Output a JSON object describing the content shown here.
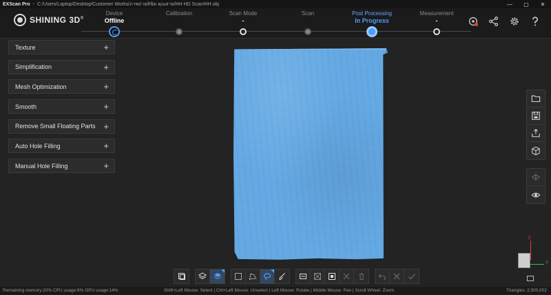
{
  "app": {
    "name": "EXScan Pro",
    "path": "C:/Users/Laptop/Desktop/Customer Works/ภาพถ่ายลิขิต คุณสาย/HH HD Scan/HH.obj",
    "logo": "SHINING 3D",
    "logo_mark": "®"
  },
  "window_controls": [
    "—",
    "▢",
    "✕"
  ],
  "steps": [
    {
      "title": "Device",
      "status": "Offline",
      "node": "sync"
    },
    {
      "title": "Calibration",
      "status": "",
      "node": "dot"
    },
    {
      "title": "Scan Mode",
      "status": "-",
      "node": "ring"
    },
    {
      "title": "Scan",
      "status": "",
      "node": "dot"
    },
    {
      "title": "Post Processing",
      "status": "In Progress",
      "node": "progress"
    },
    {
      "title": "Measurement",
      "status": "-",
      "node": "ring"
    }
  ],
  "header_icons": [
    "scanner-settings-icon",
    "share-icon",
    "gear-icon",
    "help-icon"
  ],
  "panel": {
    "items": [
      {
        "label": "Texture"
      },
      {
        "label": "Simplification"
      },
      {
        "label": "Mesh Optimization"
      },
      {
        "label": "Smooth"
      },
      {
        "label": "Remove Small Floating Parts"
      },
      {
        "label": "Auto Hole Filling"
      },
      {
        "label": "Manual Hole Filling"
      }
    ],
    "plus": "+"
  },
  "right_toolbar": [
    "folder-open-icon",
    "save-icon",
    "export-icon",
    "3d-cube-icon"
  ],
  "right_toolbar2": [
    "mesh-icon",
    "eye-icon"
  ],
  "gizmo": {
    "z": "Z",
    "y": "Y"
  },
  "status": {
    "left": "Remaining memory:20% CPU usage:6% GPU usage:14%",
    "mid": "Shift+Left Mouse: Select | Ctrl+Left Mouse: Unselect | Left Mouse: Rotate | Middle Mouse: Pan | Scroll Wheel: Zoom",
    "right": "Triangles: 2,500,002"
  },
  "colors": {
    "accent": "#4d9cff",
    "model": "#64a9e4"
  }
}
